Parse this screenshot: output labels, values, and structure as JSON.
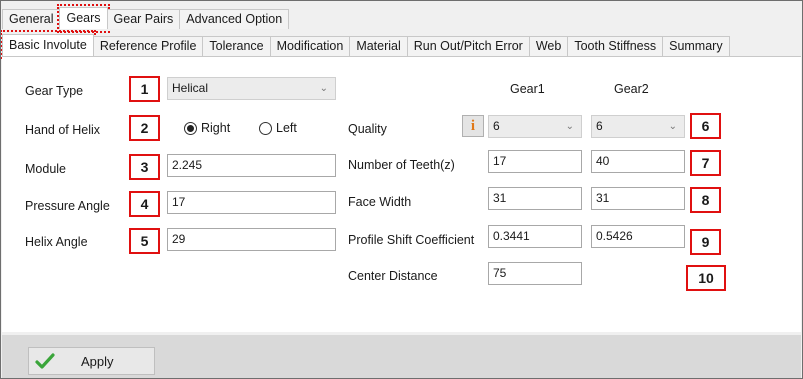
{
  "tabs_top": [
    {
      "label": "General"
    },
    {
      "label": "Gears"
    },
    {
      "label": "Gear Pairs"
    },
    {
      "label": "Advanced Option"
    }
  ],
  "tabs_sub": [
    {
      "label": "Basic Involute"
    },
    {
      "label": "Reference Profile"
    },
    {
      "label": "Tolerance"
    },
    {
      "label": "Modification"
    },
    {
      "label": "Material"
    },
    {
      "label": "Run Out/Pitch Error"
    },
    {
      "label": "Web"
    },
    {
      "label": "Tooth Stiffness"
    },
    {
      "label": "Summary"
    }
  ],
  "left": {
    "gear_type_label": "Gear Type",
    "gear_type_value": "Helical",
    "hand_label": "Hand of Helix",
    "hand_right": "Right",
    "hand_left": "Left",
    "hand_selected": "Right",
    "module_label": "Module",
    "module_value": "2.245",
    "pressure_label": "Pressure Angle",
    "pressure_value": "17",
    "helix_label": "Helix Angle",
    "helix_value": "29"
  },
  "right": {
    "gear1_header": "Gear1",
    "gear2_header": "Gear2",
    "quality_label": "Quality",
    "info_glyph": "i",
    "quality_g1": "6",
    "quality_g2": "6",
    "teeth_label": "Number of Teeth(z)",
    "teeth_g1": "17",
    "teeth_g2": "40",
    "face_label": "Face Width",
    "face_g1": "31",
    "face_g2": "31",
    "shift_label": "Profile Shift Coefficient",
    "shift_g1": "0.3441",
    "shift_g2": "0.5426",
    "center_label": "Center Distance",
    "center_value": "75"
  },
  "markers": [
    "1",
    "2",
    "3",
    "4",
    "5",
    "6",
    "7",
    "8",
    "9",
    "10"
  ],
  "footer": {
    "apply_label": "Apply",
    "apply_icon": "check-icon"
  },
  "colors": {
    "marker_red": "#e01010",
    "info_orange": "#e07818",
    "check_green": "#3aa53a"
  }
}
